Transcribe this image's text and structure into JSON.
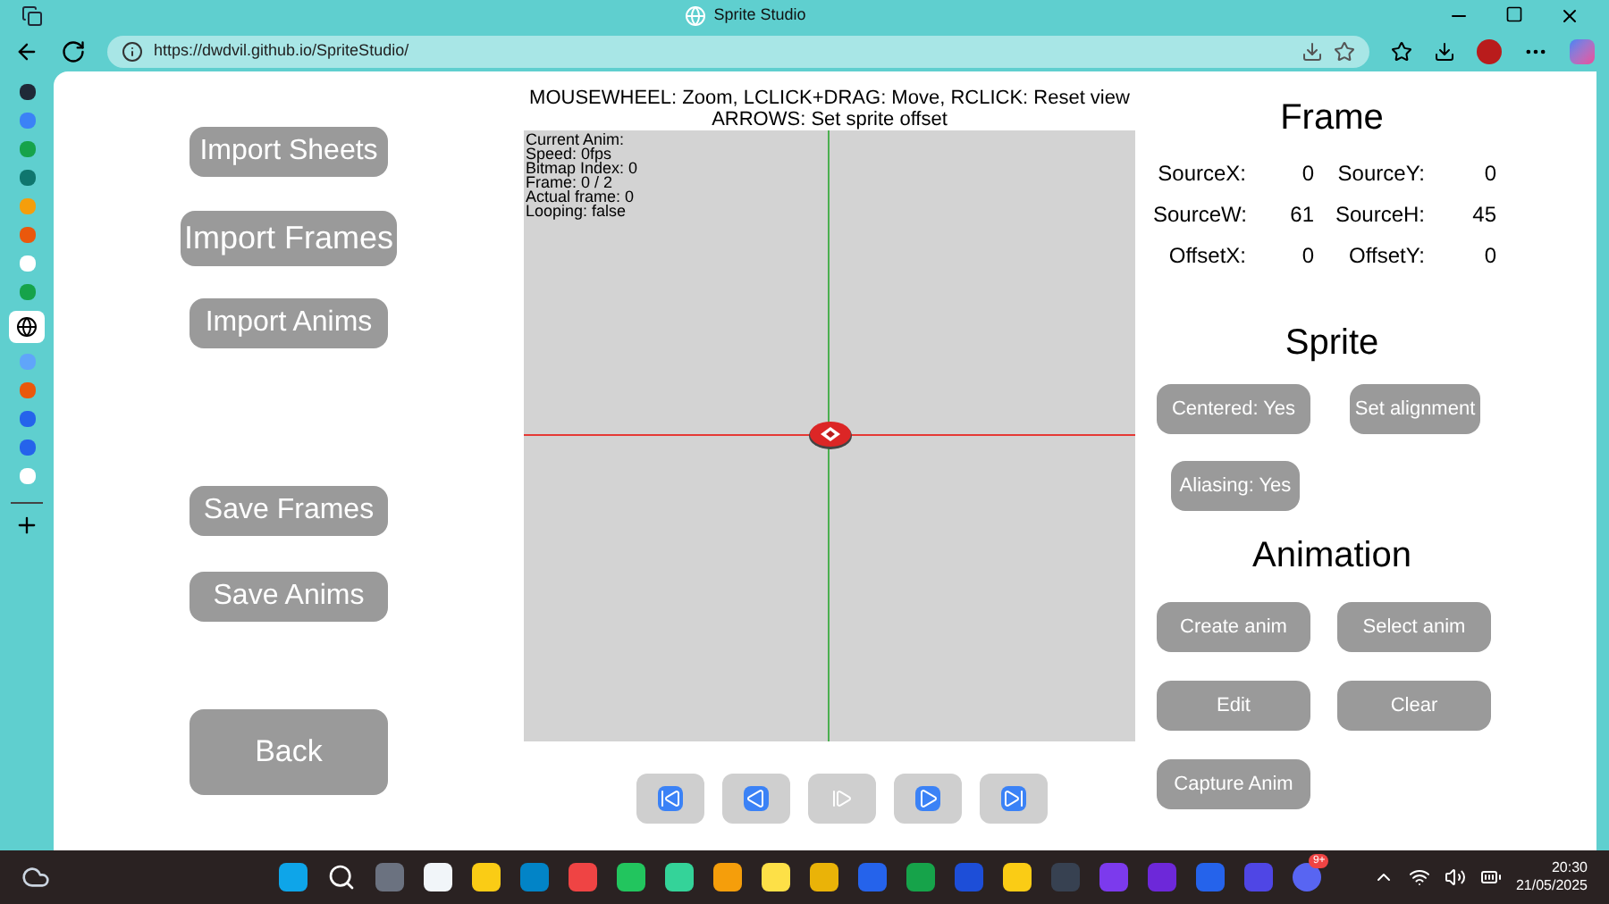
{
  "browser": {
    "title": "Sprite Studio",
    "url": "https://dwdvil.github.io/SpriteStudio/"
  },
  "left_buttons": [
    {
      "label": "Import Sheets",
      "kind": "normal"
    },
    {
      "label": "Import Frames",
      "kind": "large"
    },
    {
      "label": "Import Anims",
      "kind": "normal"
    },
    {
      "label": "Save Frames",
      "kind": "normal"
    },
    {
      "label": "Save Anims",
      "kind": "normal"
    },
    {
      "label": "Back",
      "kind": "tall"
    }
  ],
  "viewport": {
    "instructions": [
      "MOUSEWHEEL: Zoom, LCLICK+DRAG: Move, RCLICK: Reset view",
      "ARROWS: Set sprite offset"
    ],
    "info": [
      "Current Anim:",
      "Speed: 0fps",
      "Bitmap Index: 0",
      "Frame: 0 / 2",
      "Actual frame: 0",
      "Looping: false"
    ]
  },
  "playback": [
    {
      "kind": "first",
      "disabled": false
    },
    {
      "kind": "prev",
      "disabled": false
    },
    {
      "kind": "step",
      "disabled": true
    },
    {
      "kind": "play",
      "disabled": false
    },
    {
      "kind": "last",
      "disabled": false
    }
  ],
  "frame": {
    "title": "Frame",
    "fields": [
      {
        "label": "SourceX:",
        "value": "0"
      },
      {
        "label": "SourceY:",
        "value": "0"
      },
      {
        "label": "SourceW:",
        "value": "61"
      },
      {
        "label": "SourceH:",
        "value": "45"
      },
      {
        "label": "OffsetX:",
        "value": "0"
      },
      {
        "label": "OffsetY:",
        "value": "0"
      }
    ]
  },
  "sprite": {
    "title": "Sprite",
    "buttons": [
      "Centered: Yes",
      "Set alignment",
      "Aliasing: Yes"
    ]
  },
  "animation": {
    "title": "Animation",
    "buttons": [
      "Create anim",
      "Select anim",
      "Edit",
      "Clear",
      "Capture Anim"
    ]
  },
  "taskbar": {
    "badge": "9+",
    "time": "20:30",
    "date": "21/05/2025"
  }
}
